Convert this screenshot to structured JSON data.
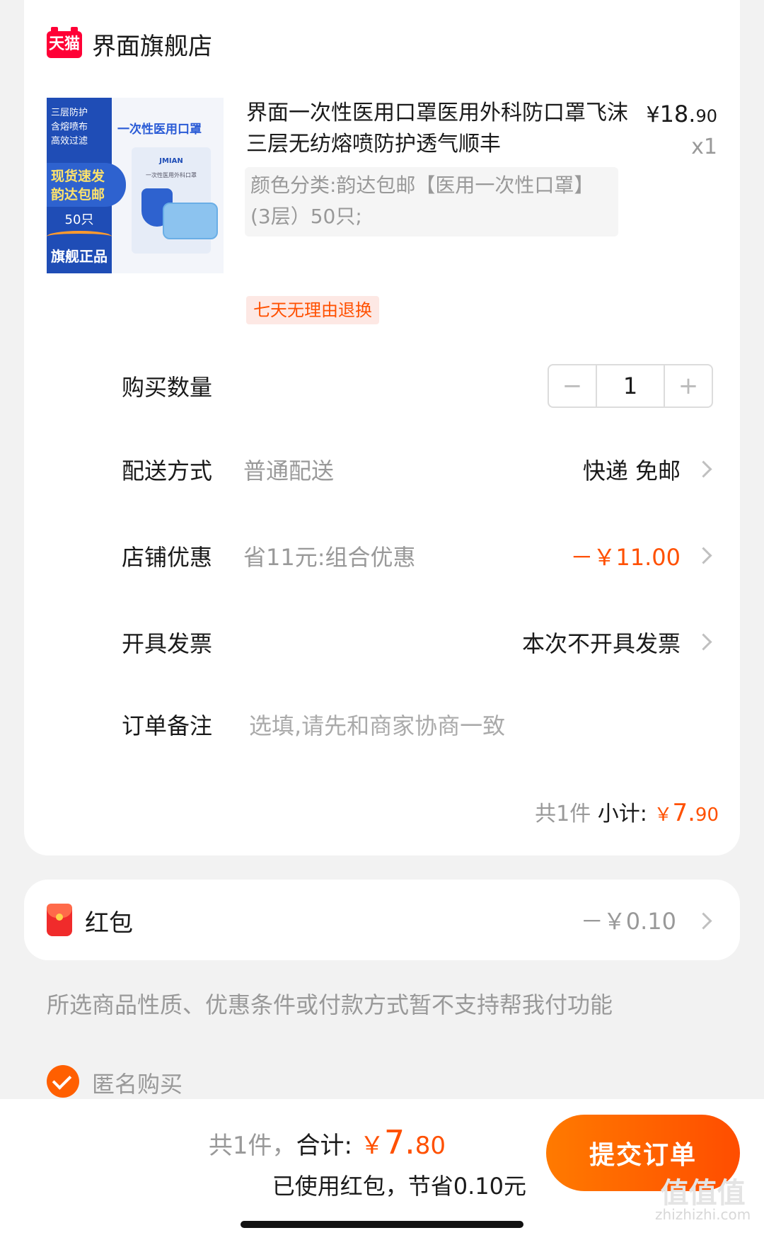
{
  "store": {
    "badge": "天猫",
    "name": "界面旗舰店"
  },
  "product": {
    "image": {
      "tags": [
        "三层防护",
        "含熔喷布",
        "高效过滤"
      ],
      "promo": "现货速发\n韵达包邮",
      "count": "50只",
      "flag": "旗舰正品",
      "title": "一次性医用口罩",
      "brand": "JMIAN",
      "box_sub": "一次性医用外科口罩"
    },
    "title": "界面一次性医用口罩医用外科防口罩飞沫三层无纺熔喷防护透气顺丰",
    "price_symbol": "¥",
    "price_int": "18.",
    "price_dec": "90",
    "quantity_mark": "x1",
    "variant": "颜色分类:韵达包邮【医用一次性口罩】(3层）50只;",
    "return_badge": "七天无理由退换"
  },
  "rows": {
    "quantity": {
      "label": "购买数量",
      "minus": "−",
      "value": "1",
      "plus": "+"
    },
    "delivery": {
      "label": "配送方式",
      "sub": "普通配送",
      "value": "快递 免邮"
    },
    "discount": {
      "label": "店铺优惠",
      "sub": "省11元:组合优惠",
      "value": "－￥11.00"
    },
    "invoice": {
      "label": "开具发票",
      "value": "本次不开具发票"
    },
    "remark": {
      "label": "订单备注",
      "placeholder": "选填,请先和商家协商一致"
    }
  },
  "subtotal": {
    "count": "共1件",
    "label": "小计:",
    "symbol": "￥",
    "amount_int": "7.",
    "amount_dec": "90"
  },
  "red_packet": {
    "label": "红包",
    "value": "－￥0.10"
  },
  "notice": "所选商品性质、优惠条件或付款方式暂不支持帮我付功能",
  "anonymous": {
    "label": "匿名购买",
    "checked": true
  },
  "bottom": {
    "count": "共1件，",
    "total_label": "合计:",
    "symbol": "￥",
    "amount_int": "7.",
    "amount_dec": "80",
    "saved": "已使用红包，节省0.10元",
    "submit": "提交订单"
  },
  "watermark": {
    "big": "值值值",
    "small": "zhizhizhi.com"
  },
  "colors": {
    "accent": "#ff5000",
    "tmall_red": "#ff0036",
    "text_gray": "#999999"
  }
}
